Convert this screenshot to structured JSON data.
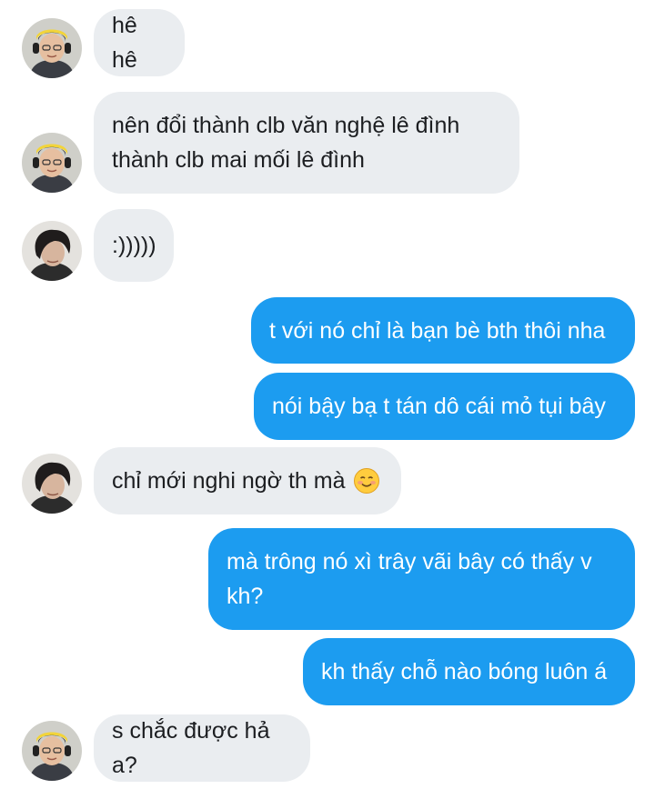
{
  "messages": [
    {
      "id": "m1",
      "direction": "incoming",
      "sender": "yellow-headband",
      "text": "hê hê"
    },
    {
      "id": "m2",
      "direction": "incoming",
      "sender": "yellow-headband",
      "text": "nên đổi thành clb văn nghệ lê đình\nthành clb mai mối lê đình"
    },
    {
      "id": "m3",
      "direction": "incoming",
      "sender": "dark-hair",
      "text": ":)))))"
    },
    {
      "id": "m4",
      "direction": "outgoing",
      "text": "t với nó chỉ là bạn bè bth thôi nha"
    },
    {
      "id": "m5",
      "direction": "outgoing",
      "text": "nói bậy bạ t tán dô cái mỏ tụi bây"
    },
    {
      "id": "m6",
      "direction": "incoming",
      "sender": "dark-hair",
      "text": "chỉ mới nghi ngờ th mà",
      "emoji": "smiling-face-icon"
    },
    {
      "id": "m7",
      "direction": "outgoing",
      "text": "mà trông nó xì trây vãi bây có thấy v\nkh?"
    },
    {
      "id": "m8",
      "direction": "outgoing",
      "text": "kh thấy chỗ nào bóng luôn á"
    },
    {
      "id": "m9",
      "direction": "incoming",
      "sender": "yellow-headband",
      "text": "s chắc được hả a?"
    }
  ],
  "colors": {
    "incoming_bubble": "#eaedf0",
    "outgoing_bubble": "#1c9cf0",
    "incoming_text": "#1c1e21",
    "outgoing_text": "#ffffff"
  }
}
